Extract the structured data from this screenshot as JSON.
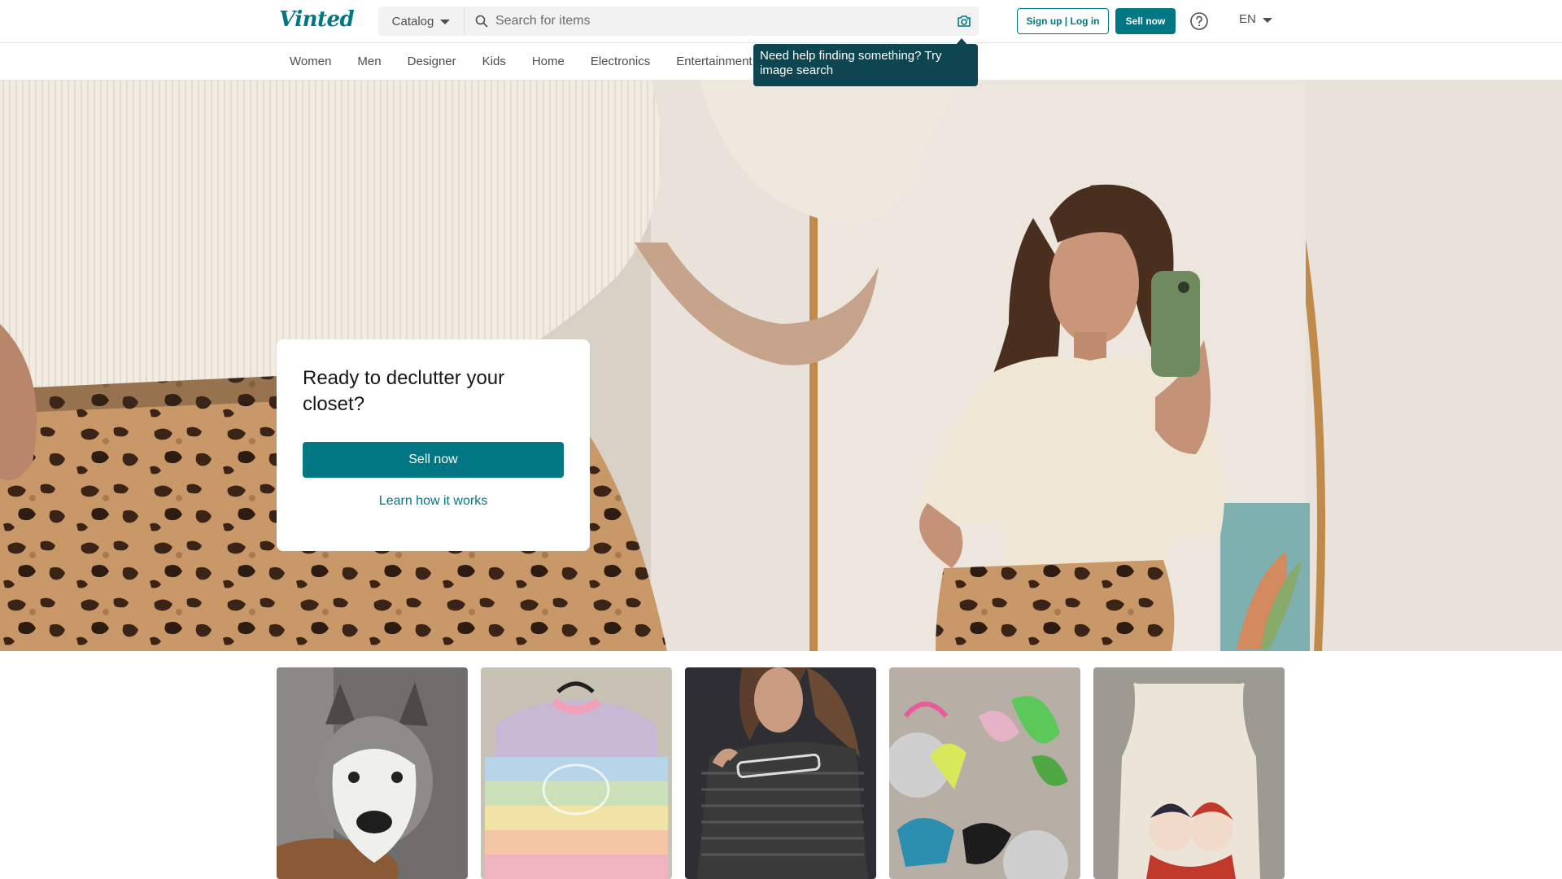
{
  "header": {
    "logo_text": "Vinted",
    "catalog_label": "Catalog",
    "search_placeholder": "Search for items",
    "signup_label": "Sign up | Log in",
    "sell_label": "Sell now",
    "language": "EN",
    "icons": [
      "search-icon",
      "camera-icon",
      "help-icon",
      "chevron-down-icon"
    ]
  },
  "nav": {
    "categories": [
      "Women",
      "Men",
      "Designer",
      "Kids",
      "Home",
      "Electronics",
      "Entertainment"
    ]
  },
  "tooltip": {
    "text": "Need help finding something? Try image search"
  },
  "hero": {
    "heading": "Ready to declutter your closet?",
    "sell_label": "Sell now",
    "learn_label": "Learn how it works"
  },
  "items": [
    {
      "name": "item-plush-husky"
    },
    {
      "name": "item-pastel-sweater"
    },
    {
      "name": "item-striped-top"
    },
    {
      "name": "item-bikinis"
    },
    {
      "name": "item-printed-tank"
    }
  ],
  "colors": {
    "brand": "#007782",
    "tooltip_bg": "#0d4650",
    "text": "#171717",
    "muted": "#4d4d4d"
  }
}
